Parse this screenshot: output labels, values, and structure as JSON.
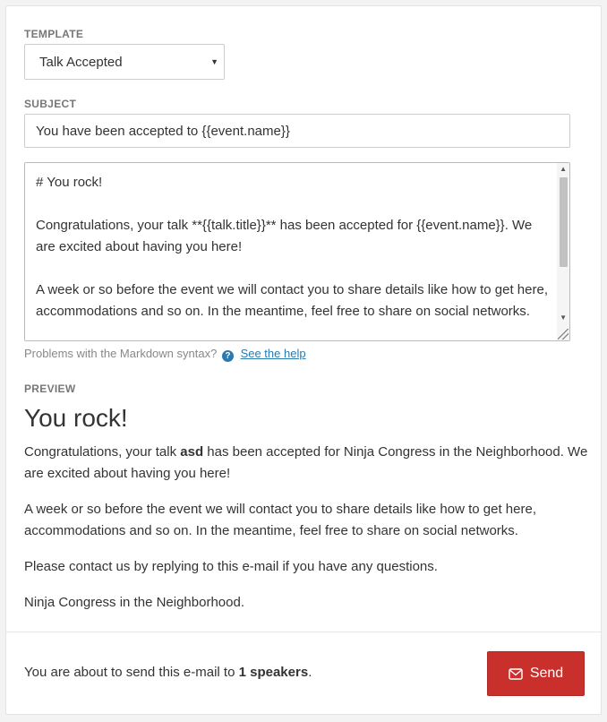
{
  "form": {
    "template_label": "TEMPLATE",
    "template_value": "Talk Accepted",
    "subject_label": "SUBJECT",
    "subject_value": "You have been accepted to {{event.name}}",
    "body_lines": [
      "# You rock!",
      "Congratulations, your talk **{{talk.title}}** has been accepted for {{event.name}}. We are excited about having you here!",
      "A week or so before the event we will contact you to share details like how to get here, accommodations and so on. In the meantime, feel free to share on social networks."
    ],
    "help_text": "Problems with the Markdown syntax?",
    "help_link": "See the help"
  },
  "preview": {
    "label": "PREVIEW",
    "title": "You rock!",
    "p1_before": "Congratulations, your talk ",
    "p1_bold": "asd",
    "p1_after": " has been accepted for Ninja Congress in the Neighborhood. We are excited about having you here!",
    "p2": "A week or so before the event we will contact you to share details like how to get here, accommodations and so on. In the meantime, feel free to share on social networks.",
    "p3": "Please contact us by replying to this e-mail if you have any questions.",
    "p4": "Ninja Congress in the Neighborhood."
  },
  "footer": {
    "text_before": "You are about to send this e-mail to ",
    "text_bold": "1 speakers",
    "text_after": ".",
    "send_label": "Send"
  },
  "icons": {
    "dropdown": "caret-down-icon",
    "help": "question-circle-icon",
    "send": "envelope-icon"
  },
  "colors": {
    "send_button": "#c9302c",
    "link": "#2a7ab0"
  }
}
